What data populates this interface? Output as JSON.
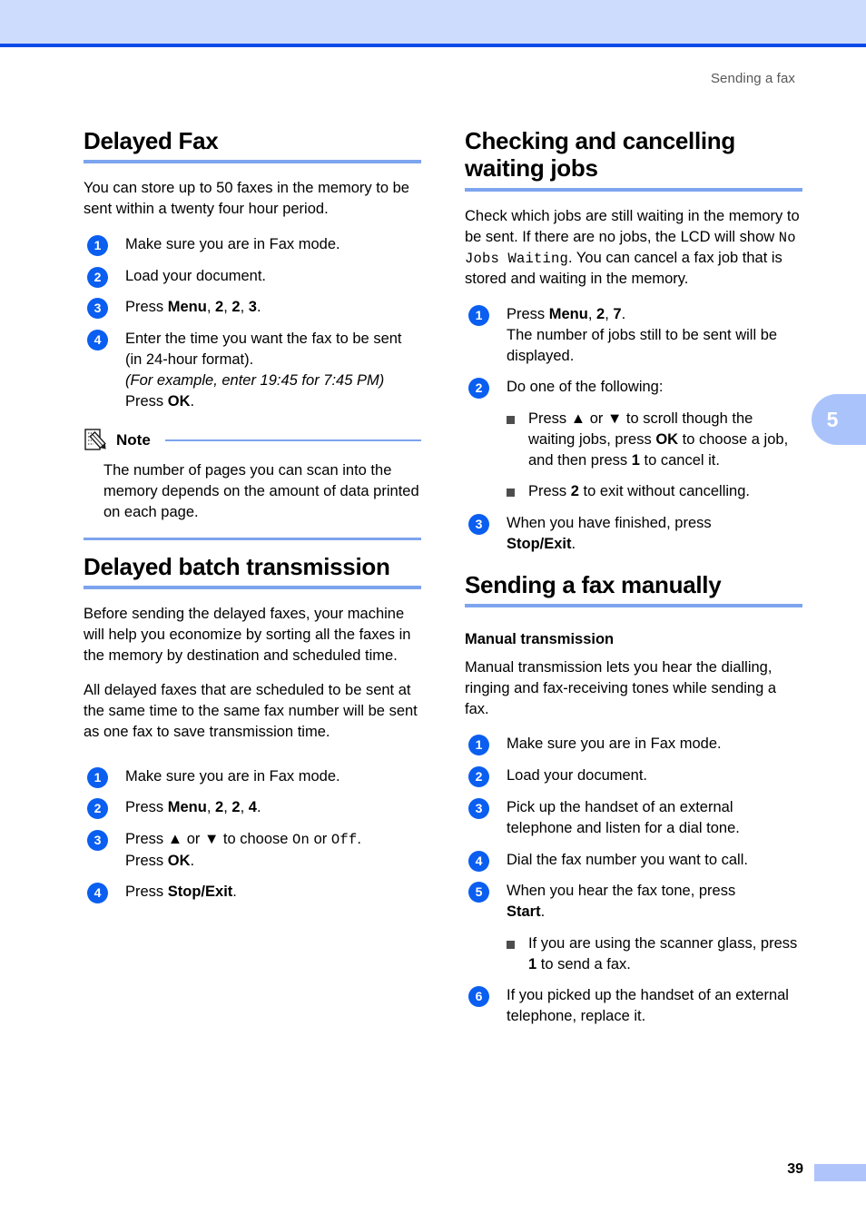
{
  "header": {
    "running_title": "Sending a fax"
  },
  "chapter_tab": {
    "number": "5"
  },
  "footer": {
    "page_number": "39"
  },
  "colors": {
    "band": "#cddcfc",
    "band_rule": "#0b4ae8",
    "heading_rule": "#7da4ee",
    "step_circle": "#0a5ef0",
    "bullet": "#4d4d4d",
    "tab": "#aac4fb",
    "footer_block": "#aec4fb",
    "header_text": "#58585a"
  },
  "left_column": {
    "section1": {
      "heading": "Delayed Fax",
      "intro": "You can store up to 50 faxes in the memory to be sent within a twenty four hour period.",
      "steps": [
        {
          "num": "1",
          "text": "Make sure you are in Fax mode."
        },
        {
          "num": "2",
          "text": "Load your document."
        },
        {
          "num": "3",
          "text": "Press Menu, 2, 2, 3."
        },
        {
          "num": "4",
          "text": "Enter the time you want the fax to be sent (in 24-hour format). (For example, enter 19:45 for 7:45 PM) Press OK."
        }
      ],
      "step3_parts": {
        "lead": "Press ",
        "bold_menu": "Menu",
        "sep1": ", ",
        "bold_n1": "2",
        "sep2": ", ",
        "bold_n2": "2",
        "sep3": ", ",
        "bold_n3": "3",
        "end": "."
      },
      "step4_parts": {
        "line1": "Enter the time you want the fax to be sent (in 24-hour format).",
        "line2_italic": "(For example, enter 19:45 for 7:45 PM)",
        "line3_lead": "Press ",
        "line3_bold": "OK",
        "line3_end": "."
      },
      "note": {
        "icon": "note-pencil-icon",
        "title": "Note",
        "body": "The number of pages you can scan into the memory depends on the amount of data printed on each page."
      }
    },
    "section2": {
      "heading": "Delayed batch transmission",
      "paragraphs": [
        "Before sending the delayed faxes, your machine will help you economize by sorting all the faxes in the memory by destination and scheduled time.",
        "All delayed faxes that are scheduled to be sent at the same time to the same fax number will be sent as one fax to save transmission time."
      ],
      "steps": [
        {
          "num": "1",
          "text": "Make sure you are in Fax mode."
        },
        {
          "num": "2",
          "text": "Press Menu, 2, 2, 4."
        },
        {
          "num": "3",
          "text": "Press ▲ or ▼ to choose On or Off. Press OK."
        },
        {
          "num": "4",
          "text": "Press Stop/Exit."
        }
      ],
      "step2_parts": {
        "lead": "Press ",
        "bold_menu": "Menu",
        "sep1": ", ",
        "bold_n1": "2",
        "sep2": ", ",
        "bold_n2": "2",
        "sep3": ", ",
        "bold_n3": "4",
        "end": "."
      },
      "step3_parts": {
        "lead": "Press ",
        "up_arrow": "▲",
        "or": " or ",
        "down_arrow": "▼",
        "mid": " to choose ",
        "lcd_on": "On",
        "or2": " or ",
        "lcd_off": "Off",
        "dot": ".",
        "line2_lead": "Press ",
        "line2_bold": "OK",
        "line2_end": "."
      },
      "step4_parts": {
        "lead": "Press ",
        "bold": "Stop/Exit",
        "end": "."
      }
    }
  },
  "right_column": {
    "section1": {
      "heading_line1": "Checking and cancelling",
      "heading_line2": "waiting jobs",
      "intro_parts": {
        "p1": "Check which jobs are still waiting in the memory to be sent. If there are no jobs, the LCD will show ",
        "lcd": "No Jobs Waiting",
        "p2": ". You can cancel a fax job that is stored and waiting in the memory."
      },
      "steps": [
        {
          "num": "1",
          "text": "Press Menu, 2, 7. The number of jobs still to be sent will be displayed."
        },
        {
          "num": "2",
          "text": "Do one of the following:"
        },
        {
          "num": "3",
          "text": "When you have finished, press Stop/Exit."
        }
      ],
      "step1_parts": {
        "lead": "Press ",
        "bold_menu": "Menu",
        "sep1": ", ",
        "bold_n1": "2",
        "sep2": ", ",
        "bold_n2": "7",
        "end": ".",
        "line2": "The number of jobs still to be sent will be displayed."
      },
      "step2_bullets": [
        {
          "lead": "Press ",
          "up_arrow": "▲",
          "or": " or ",
          "down_arrow": "▼",
          "mid": " to scroll though the waiting jobs, press ",
          "bold1": "OK",
          "mid2": " to choose a job, and then press ",
          "bold2": "1",
          "end": " to cancel it."
        },
        {
          "lead": "Press ",
          "bold1": "2",
          "end": " to exit without cancelling."
        }
      ],
      "step3_parts": {
        "line1": "When you have finished, press",
        "line2_bold": "Stop/Exit",
        "line2_end": "."
      }
    },
    "section2": {
      "heading": "Sending a fax manually",
      "subheading": "Manual transmission",
      "paragraph": "Manual transmission lets you hear the dialling, ringing and fax-receiving tones while sending a fax.",
      "steps": [
        {
          "num": "1",
          "text": "Make sure you are in Fax mode."
        },
        {
          "num": "2",
          "text": "Load your document."
        },
        {
          "num": "3",
          "text": "Pick up the handset of an external telephone and listen for a dial tone."
        },
        {
          "num": "4",
          "text": "Dial the fax number you want to call."
        },
        {
          "num": "5",
          "text": "When you hear the fax tone, press Start."
        },
        {
          "num": "6",
          "text": "If you picked up the handset of an external telephone, replace it."
        }
      ],
      "step5_parts": {
        "line1": "When you hear the fax tone, press",
        "line2_bold": "Start",
        "line2_end": "."
      },
      "step5_bullet": {
        "lead": "If you are using the scanner glass, press ",
        "bold": "1",
        "end": " to send a fax."
      }
    }
  }
}
